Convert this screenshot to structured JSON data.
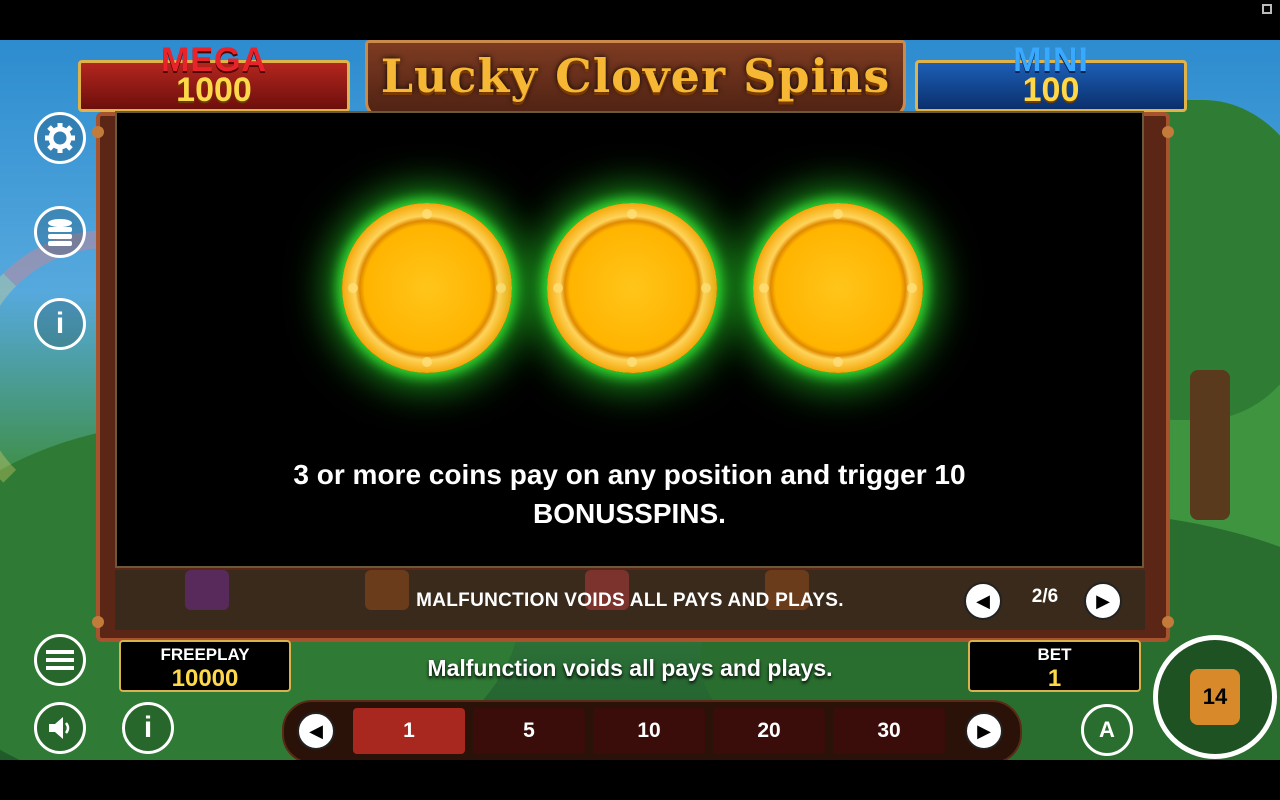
{
  "title": "Lucky Clover Spins",
  "jackpots": {
    "mega": {
      "label": "MEGA",
      "value": "1000"
    },
    "mini": {
      "label": "MINI",
      "value": "100"
    }
  },
  "paytable": {
    "text_line1": "3 or more coins pay on any position and trigger 10",
    "text_line2": "BONUSSPINS.",
    "voids_notice": "MALFUNCTION VOIDS ALL PAYS AND PLAYS.",
    "page": "2/6"
  },
  "footer": {
    "freeplay_label": "FREEPLAY",
    "freeplay_value": "10000",
    "malfunction_text": "Malfunction voids all pays and plays.",
    "bet_label": "BET",
    "bet_value": "1"
  },
  "bet_options": [
    "1",
    "5",
    "10",
    "20",
    "30"
  ],
  "selected_bet": "1",
  "spin_badge": "14",
  "auto_label": "A",
  "icons": {
    "settings": "gear-icon",
    "coins": "coin-stack-icon",
    "info": "info-icon",
    "menu": "menu-icon",
    "sound": "speaker-icon",
    "prev": "chevron-left-icon",
    "next": "chevron-right-icon"
  },
  "colors": {
    "mega_red": "#b3261e",
    "mini_blue": "#1c5fb6",
    "gold": "#ffd84a",
    "coin_glow": "#3fe03f",
    "bet_active": "#a82820"
  }
}
